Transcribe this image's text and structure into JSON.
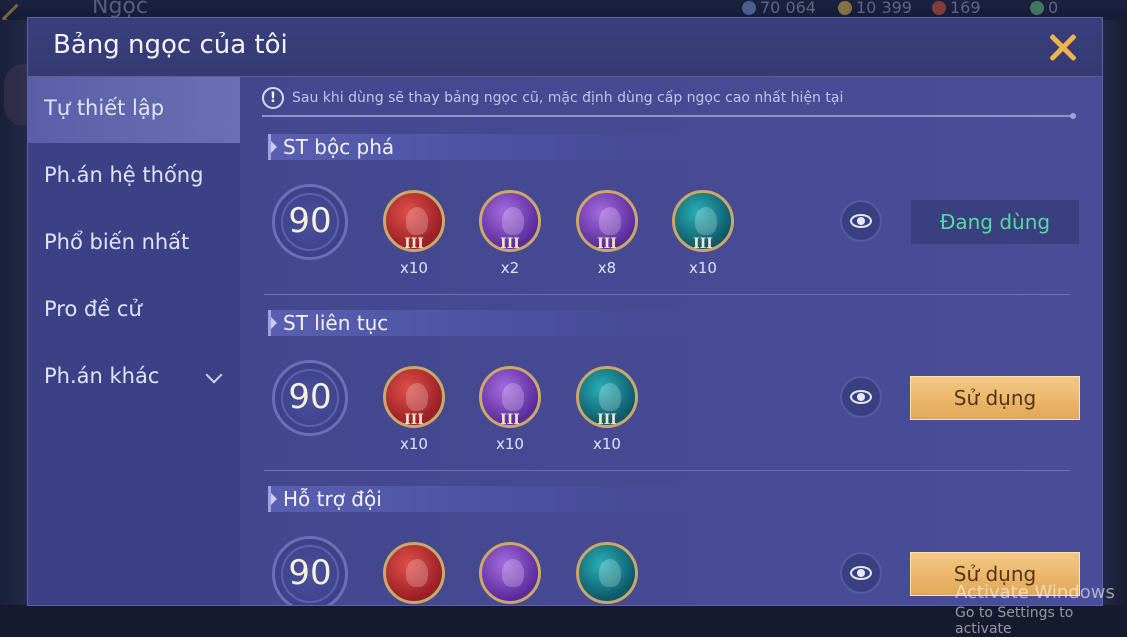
{
  "background": {
    "title": "Ngọc",
    "resources": [
      {
        "value": "70 064",
        "color": "#6b88c8",
        "icon": "blue-gem-icon"
      },
      {
        "value": "10 399",
        "color": "#c9a84a",
        "icon": "gold-coin-icon"
      },
      {
        "value": "169",
        "color": "#c8503a",
        "icon": "red-gem-icon"
      },
      {
        "value": "0",
        "color": "#5fae7c",
        "icon": "green-crystal-icon"
      }
    ]
  },
  "modal": {
    "title": "Bảng ngọc của tôi",
    "close_icon": "close-icon"
  },
  "sidebar": {
    "items": [
      {
        "label": "Tự thiết lập",
        "active": true
      },
      {
        "label": "Ph.án hệ thống",
        "active": false
      },
      {
        "label": "Phổ biến nhất",
        "active": false
      },
      {
        "label": "Pro đề cử",
        "active": false
      },
      {
        "label": "Ph.án khác",
        "active": false,
        "icon": "chevron-down-icon"
      }
    ]
  },
  "notice": {
    "icon": "exclamation-icon",
    "text": "Sau khi dùng sẽ thay bảng ngọc cũ, mặc định dùng cấp ngọc cao nhất hiện tại"
  },
  "sections": [
    {
      "title": "ST bộc phá",
      "level": "90",
      "gems": [
        {
          "color": "red",
          "tier": "III",
          "count": "x10"
        },
        {
          "color": "purple",
          "tier": "III",
          "count": "x2"
        },
        {
          "color": "purple",
          "tier": "III",
          "count": "x8"
        },
        {
          "color": "teal",
          "tier": "III",
          "count": "x10"
        }
      ],
      "button": "Đang dùng",
      "in_use": true
    },
    {
      "title": "ST liên tục",
      "level": "90",
      "gems": [
        {
          "color": "red",
          "tier": "III",
          "count": "x10"
        },
        {
          "color": "purple",
          "tier": "III",
          "count": "x10"
        },
        {
          "color": "teal",
          "tier": "III",
          "count": "x10"
        }
      ],
      "button": "Sử dụng",
      "in_use": false
    },
    {
      "title": "Hỗ trợ đội",
      "level": "90",
      "gems": [
        {
          "color": "red",
          "tier": "",
          "count": ""
        },
        {
          "color": "purple",
          "tier": "",
          "count": ""
        },
        {
          "color": "teal",
          "tier": "",
          "count": ""
        }
      ],
      "button": "Sử dụng",
      "in_use": false
    }
  ],
  "os_watermark": {
    "line1": "Activate Windows",
    "line2": "Go to Settings to activate"
  }
}
